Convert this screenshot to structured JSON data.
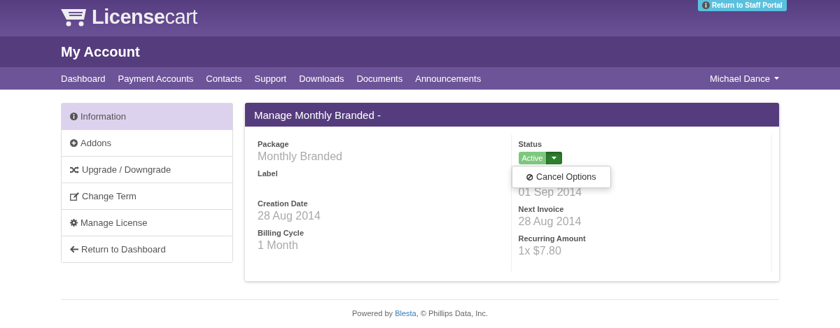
{
  "header": {
    "logo": "**License**cart",
    "staff_portal_button": "Return to Staff Portal"
  },
  "page_title": "My Account",
  "nav": {
    "items": [
      {
        "label": "Dashboard"
      },
      {
        "label": "Payment Accounts"
      },
      {
        "label": "Contacts"
      },
      {
        "label": "Support"
      },
      {
        "label": "Downloads"
      },
      {
        "label": "Documents"
      },
      {
        "label": "Announcements"
      }
    ],
    "user": "Michael Dance"
  },
  "sidebar": {
    "items": [
      {
        "label": "Information",
        "selected": true
      },
      {
        "label": "Addons",
        "selected": false
      },
      {
        "label": "Upgrade / Downgrade",
        "selected": false
      },
      {
        "label": "Change Term",
        "selected": false
      },
      {
        "label": "Manage License",
        "selected": false
      },
      {
        "label": "Return to Dashboard",
        "selected": false
      }
    ]
  },
  "panel": {
    "title": "Manage Monthly Branded -",
    "left_fields": [
      {
        "label": "Package",
        "value": "Monthly Branded"
      },
      {
        "label": "Label"
      },
      {
        "label": "Creation Date",
        "value": "28 Aug 2014"
      },
      {
        "label": "Billing Cycle",
        "value": "1 Month"
      }
    ],
    "status": {
      "label": "Status",
      "value": "Active",
      "menu": {
        "expanded": true,
        "items": [
          "Cancel Options"
        ]
      }
    },
    "right_fields": [
      {
        "value": "01 Sep 2014"
      },
      {
        "label": "Next Invoice",
        "value": "28 Aug 2014"
      },
      {
        "label": "Recurring Amount",
        "value": "1x $7.80"
      }
    ]
  },
  "footer": {
    "prefix": "Powered by ",
    "link": "Blesta",
    "suffix": ", © Phillips Data, Inc."
  }
}
